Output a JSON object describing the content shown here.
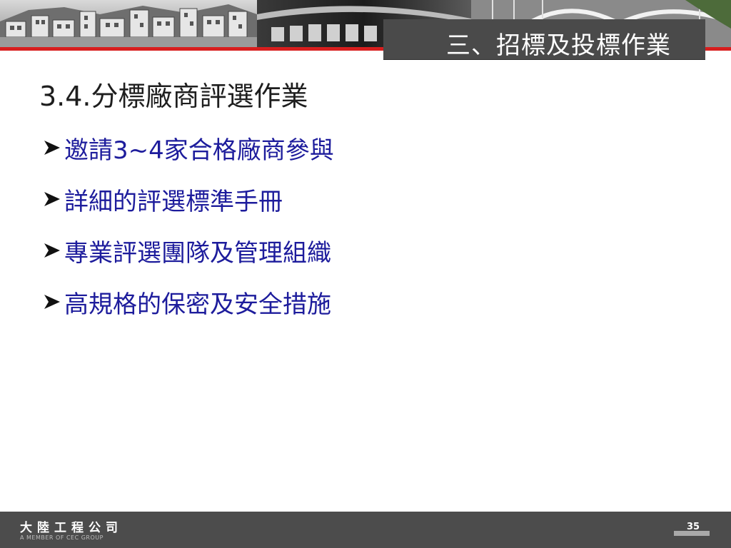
{
  "header": {
    "section_title": "三、招標及投標作業"
  },
  "main": {
    "heading": "3.4.分標廠商評選作業",
    "bullets": [
      {
        "label": "邀請3~4家合格廠商參與"
      },
      {
        "label": "詳細的評選標準手冊"
      },
      {
        "label": "專業評選團隊及管理組織"
      },
      {
        "label": "高規格的保密及安全措施"
      }
    ],
    "bullet_icon": "arrowhead-bullet-icon"
  },
  "footer": {
    "company": "大陸工程公司",
    "tagline": "A MEMBER OF CEC GROUP",
    "page_number": "35"
  },
  "colors": {
    "accent_red": "#d81e1e",
    "bullet_text": "#1d1c9c",
    "title_box": "#4a4a4a",
    "footer_bg": "#4c4c4c"
  }
}
